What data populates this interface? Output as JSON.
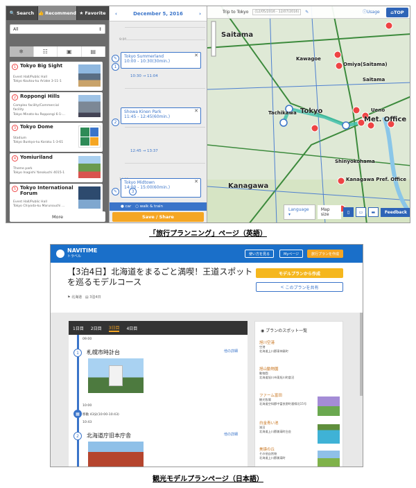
{
  "en": {
    "tabs": [
      {
        "icon": "search-icon",
        "label": "Search"
      },
      {
        "icon": "thumbs-up-icon",
        "label": "Recommend"
      },
      {
        "icon": "star-icon",
        "label": "Favorite"
      }
    ],
    "area_select": "All",
    "spots": [
      {
        "num": "1",
        "name": "Tokyo Big Sight",
        "lines": [
          "Event Hall/Public Hall",
          "Tokyo Koutou-ku Ariake 3-11-1"
        ]
      },
      {
        "num": "2",
        "name": "Roppongi Hills",
        "lines": [
          "Complex facility/Commercial",
          "facility",
          "Tokyo Minato-ku Roppongi 6-1-..."
        ]
      },
      {
        "num": "3",
        "name": "Tokyo Dome",
        "lines": [
          "Stadium",
          "Tokyo Bunkyo-ku Koraku 1-3-61"
        ]
      },
      {
        "num": "4",
        "name": "Yomiuriland",
        "lines": [
          "Theme park",
          "Tokyo Inagishi Yanokuchi 4015-1"
        ]
      },
      {
        "num": "5",
        "name": "Tokyo International Forum",
        "lines": [
          "Event Hall/Public Hall",
          "Tokyo Chiyoda-ku Marunouchi ..."
        ]
      }
    ],
    "more": "More",
    "date": "December 5, 2016",
    "hours": [
      "8:00",
      "9:00",
      "10:00",
      "11:00",
      "12:00",
      "13:00",
      "14:00"
    ],
    "cards": [
      {
        "name": "Tokyo Summerland",
        "time": "10:00 - 10:30(30min.)",
        "pin": "1"
      },
      {
        "name": "Showa Kinen Park",
        "time": "11:45 - 12:45(60min.)",
        "pin": "2"
      },
      {
        "name": "Tokyo Midtown",
        "time": "14:00 - 15:00(60min.)",
        "pin": "3"
      }
    ],
    "travels": [
      "10:30 → 11:04",
      "12:45 → 13:37"
    ],
    "modes": [
      "car",
      "walk & train"
    ],
    "save": "Save / Share",
    "trip_title": "Trip to Tokyo",
    "trip_range": "(12/05/2016 - 12/07/2016)",
    "usage": "Usage",
    "top": "TOP",
    "map_labels": [
      {
        "t": "Saitama",
        "c": "lbl"
      },
      {
        "t": "Tokyo",
        "c": "lbl"
      },
      {
        "t": "Kanagawa",
        "c": "lbl"
      },
      {
        "t": "Omiya(Saitama)",
        "c": "sm"
      },
      {
        "t": "Ueno",
        "c": "sm"
      },
      {
        "t": "Met. Office",
        "c": "lbl"
      },
      {
        "t": "Shinyokohama",
        "c": "sm"
      },
      {
        "t": "Kanagawa Pref. Office",
        "c": "sm"
      },
      {
        "t": "Saitama",
        "c": "sm"
      },
      {
        "t": "Kawagoe",
        "c": "sm"
      },
      {
        "t": "Tachikawa",
        "c": "sm"
      }
    ],
    "language": "Language",
    "map_size": "Map size",
    "feedback": "Feedback",
    "caption": "「旅行プランニング」ページ（英語）"
  },
  "ja": {
    "brand": "NAVITIME",
    "brand_sub": "トラベル",
    "header_buttons": [
      "使い方を見る",
      "Myページ",
      "旅行プランを作成"
    ],
    "title": "【3泊4日】北海道をまるごと満喫！王道スポットを巡るモデルコース",
    "meta": [
      "北海道",
      "3泊4日"
    ],
    "create_btn": "モデルプランから作成",
    "share_btn": "このプランを共有",
    "days": [
      "1日目",
      "2日目",
      "3日目",
      "4日目"
    ],
    "active_day": 2,
    "times": [
      "09:00",
      "10:00",
      "10:43"
    ],
    "spots": [
      {
        "num": "1",
        "name": "札幌市時計台",
        "detail": "他の詳細"
      },
      {
        "num": "2",
        "name": "北海道庁旧本庁舎",
        "detail": "他の詳細"
      }
    ],
    "transit": "移動 43分(10:00-10:43)",
    "side_title": "プランのスポット一覧",
    "side_items": [
      {
        "name": "旭川空港",
        "desc": [
          "空港",
          "北海道上川郡東神楽町"
        ]
      },
      {
        "name": "旭山動物園",
        "desc": [
          "動物園",
          "北海道旭川市東旭川町倉沼"
        ]
      },
      {
        "name": "ファーム富田",
        "desc": [
          "観光牧場",
          "北海道空知郡中富良野町基線北15号"
        ]
      },
      {
        "name": "白金青い池",
        "desc": [
          "湖沼",
          "北海道上川郡美瑛町白金"
        ]
      },
      {
        "name": "美瑛の丘",
        "desc": [
          "その他自然物",
          "北海道上川郡美瑛町"
        ]
      }
    ],
    "caption": "観光モデルプランページ（日本語）"
  }
}
